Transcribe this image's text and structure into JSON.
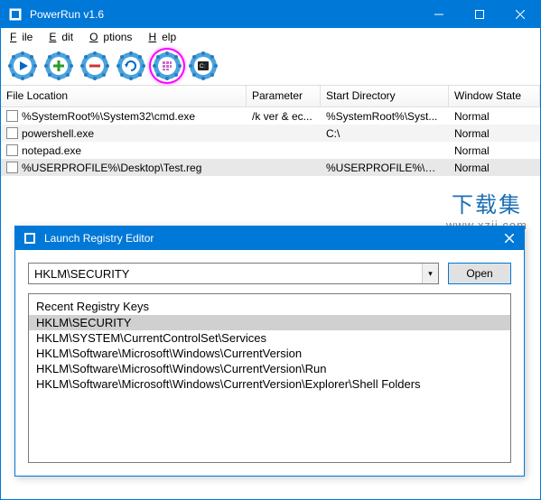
{
  "main_window": {
    "title": "PowerRun v1.6",
    "menu": {
      "file": "File",
      "edit": "Edit",
      "options": "Options",
      "help": "Help"
    },
    "columns": {
      "location": "File Location",
      "parameter": "Parameter",
      "start_dir": "Start Directory",
      "window_state": "Window State"
    },
    "rows": [
      {
        "location": "%SystemRoot%\\System32\\cmd.exe",
        "parameter": "/k ver & ec...",
        "start_dir": "%SystemRoot%\\Syst...",
        "window_state": "Normal"
      },
      {
        "location": "powershell.exe",
        "parameter": "",
        "start_dir": "C:\\",
        "window_state": "Normal"
      },
      {
        "location": "notepad.exe",
        "parameter": "",
        "start_dir": "",
        "window_state": "Normal"
      },
      {
        "location": "%USERPROFILE%\\Desktop\\Test.reg",
        "parameter": "",
        "start_dir": "%USERPROFILE%\\De...",
        "window_state": "Normal"
      }
    ]
  },
  "watermark": {
    "line1": "下载集",
    "line2": "www.xzji.com"
  },
  "dialog": {
    "title": "Launch Registry Editor",
    "input_value": "HKLM\\SECURITY",
    "open_label": "Open",
    "recent_label": "Recent Registry Keys",
    "recent": [
      "HKLM\\SECURITY",
      "HKLM\\SYSTEM\\CurrentControlSet\\Services",
      "HKLM\\Software\\Microsoft\\Windows\\CurrentVersion",
      "HKLM\\Software\\Microsoft\\Windows\\CurrentVersion\\Run",
      "HKLM\\Software\\Microsoft\\Windows\\CurrentVersion\\Explorer\\Shell Folders"
    ]
  }
}
